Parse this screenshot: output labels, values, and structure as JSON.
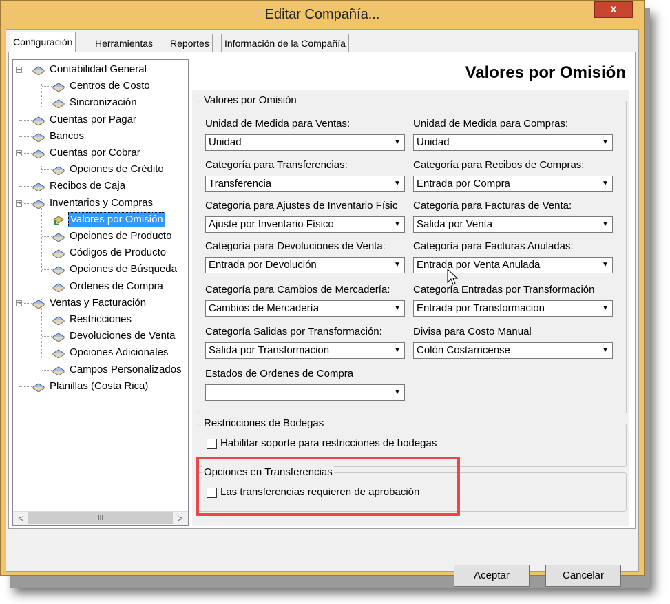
{
  "window": {
    "title": "Editar Compañía...",
    "close_glyph": "x"
  },
  "tabs": [
    {
      "label": "Configuración",
      "active": true
    },
    {
      "label": "Herramientas",
      "active": false
    },
    {
      "label": "Reportes",
      "active": false
    },
    {
      "label": "Información de la Compañía",
      "active": false
    }
  ],
  "tree": {
    "nodes": [
      {
        "label": "Contabilidad General",
        "level": 0,
        "expander": "−"
      },
      {
        "label": "Centros de Costo",
        "level": 1
      },
      {
        "label": "Sincronización",
        "level": 1
      },
      {
        "label": "Cuentas por Pagar",
        "level": 0
      },
      {
        "label": "Bancos",
        "level": 0
      },
      {
        "label": "Cuentas por Cobrar",
        "level": 0,
        "expander": "−"
      },
      {
        "label": "Opciones de Crédito",
        "level": 1
      },
      {
        "label": "Recibos de Caja",
        "level": 0
      },
      {
        "label": "Inventarios y Compras",
        "level": 0,
        "expander": "−"
      },
      {
        "label": "Valores por Omisión",
        "level": 1,
        "selected": true
      },
      {
        "label": "Opciones de Producto",
        "level": 1
      },
      {
        "label": "Códigos de Producto",
        "level": 1
      },
      {
        "label": "Opciones de Búsqueda",
        "level": 1
      },
      {
        "label": "Ordenes de Compra",
        "level": 1
      },
      {
        "label": "Ventas y Facturación",
        "level": 0,
        "expander": "−"
      },
      {
        "label": "Restricciones",
        "level": 1
      },
      {
        "label": "Devoluciones de Venta",
        "level": 1
      },
      {
        "label": "Opciones Adicionales",
        "level": 1
      },
      {
        "label": "Campos Personalizados",
        "level": 1
      },
      {
        "label": "Planillas (Costa Rica)",
        "level": 0
      }
    ],
    "scroll_left": "<",
    "scroll_right": ">",
    "scroll_thumb": "III"
  },
  "page_header": "Valores por Omisión",
  "defaults_group": {
    "legend": "Valores por Omisión",
    "fields": [
      {
        "label": "Unidad de Medida para Ventas:",
        "value": "Unidad"
      },
      {
        "label": "Unidad de Medida para Compras:",
        "value": "Unidad"
      },
      {
        "label": "Categoría para Transferencias:",
        "value": "Transferencia"
      },
      {
        "label": "Categoría para Recibos de Compras:",
        "value": "Entrada por Compra"
      },
      {
        "label": "Categoría para Ajustes de Inventario Físic",
        "value": "Ajuste por Inventario Físico"
      },
      {
        "label": "Categoría para Facturas de Venta:",
        "value": "Salida por Venta"
      },
      {
        "label": "Categoría para Devoluciones de Venta:",
        "value": "Entrada por Devolución"
      },
      {
        "label": "Categoría para Facturas Anuladas:",
        "value": "Entrada por Venta Anulada"
      },
      {
        "label": "Categoría para Cambios de Mercadería:",
        "value": "Cambios de Mercadería"
      },
      {
        "label": "Categoría Entradas por Transformación",
        "value": "Entrada por Transformacion"
      },
      {
        "label": "Categoría Salidas por Transformación:",
        "value": "Salida por Transformacion"
      },
      {
        "label": "Divisa para Costo Manual",
        "value": "Colón Costarricense"
      },
      {
        "label": "Estados de Ordenes de Compra",
        "value": ""
      }
    ]
  },
  "warehouse_group": {
    "legend": "Restricciones de Bodegas",
    "checkbox_label": "Habilitar soporte para restricciones de bodegas",
    "checked": false
  },
  "transfer_group": {
    "legend": "Opciones en Transferencias",
    "checkbox_label": "Las transferencias requieren de aprobación",
    "checked": false
  },
  "buttons": {
    "accept": "Aceptar",
    "cancel": "Cancelar"
  },
  "colors": {
    "selection": "#3399ff",
    "highlight_box": "#e8484b",
    "close_button": "#c6462f"
  }
}
